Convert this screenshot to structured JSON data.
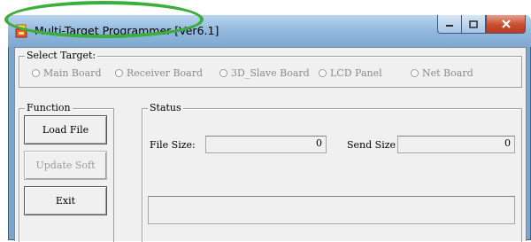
{
  "window": {
    "title": "Multi-Target Programmer [Ver6.1]",
    "controls": {
      "minimize": "minimize",
      "maximize": "maximize",
      "close": "close"
    }
  },
  "select_target": {
    "label": "Select Target:",
    "options": [
      {
        "label": "Main Board",
        "selected": false,
        "enabled": false
      },
      {
        "label": "Receiver Board",
        "selected": false,
        "enabled": false
      },
      {
        "label": "3D_Slave Board",
        "selected": false,
        "enabled": false
      },
      {
        "label": "LCD Panel",
        "selected": false,
        "enabled": false
      },
      {
        "label": "Net Board",
        "selected": false,
        "enabled": false
      }
    ]
  },
  "function": {
    "label": "Function",
    "buttons": {
      "load_file": "Load File",
      "update_soft": "Update Soft",
      "exit": "Exit"
    }
  },
  "status": {
    "label": "Status",
    "file_size_label": "File Size:",
    "file_size_value": "0",
    "send_size_label": "Send Size",
    "send_size_value": "0",
    "log_text": ""
  },
  "colors": {
    "highlight": "#3cae3c",
    "title_bar": "#8fb6dc",
    "close_button": "#c84c2e",
    "dialog_bg": "#f0f0f0"
  },
  "icons": [
    "app-icon",
    "minimize-icon",
    "maximize-icon",
    "close-icon"
  ]
}
